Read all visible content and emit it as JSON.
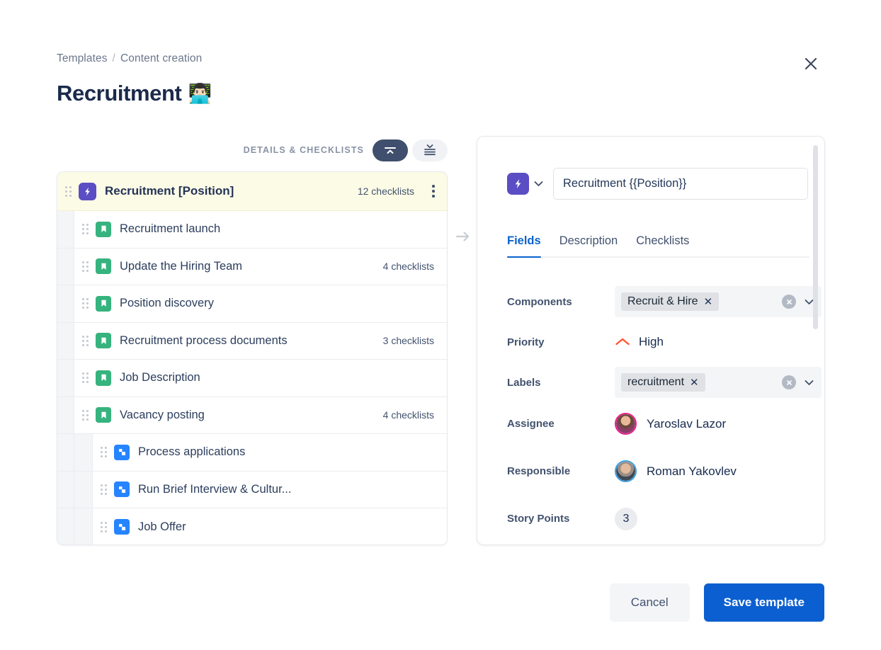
{
  "breadcrumb": {
    "root": "Templates",
    "separator": "/",
    "current": "Content creation"
  },
  "title": {
    "text": "Recruitment",
    "emoji": "👨🏻‍💻"
  },
  "close_icon": "close-icon",
  "toolbar": {
    "label": "DETAILS & CHECKLISTS",
    "collapse_icon": "collapse-all-icon",
    "expand_icon": "expand-all-icon"
  },
  "tree": {
    "items": [
      {
        "title": "Recruitment [Position]",
        "meta": "12 checklists",
        "type": "epic",
        "level": 0,
        "selected": true,
        "has_menu": true
      },
      {
        "title": "Recruitment launch",
        "meta": "",
        "type": "story",
        "level": 1,
        "selected": false,
        "has_menu": false
      },
      {
        "title": "Update the Hiring Team",
        "meta": "4 checklists",
        "type": "story",
        "level": 1,
        "selected": false,
        "has_menu": false
      },
      {
        "title": "Position discovery",
        "meta": "",
        "type": "story",
        "level": 1,
        "selected": false,
        "has_menu": false
      },
      {
        "title": "Recruitment process documents",
        "meta": "3 checklists",
        "type": "story",
        "level": 1,
        "selected": false,
        "has_menu": false
      },
      {
        "title": "Job Description",
        "meta": "",
        "type": "story",
        "level": 1,
        "selected": false,
        "has_menu": false
      },
      {
        "title": "Vacancy posting",
        "meta": "4 checklists",
        "type": "story",
        "level": 1,
        "selected": false,
        "has_menu": false
      },
      {
        "title": "Process applications",
        "meta": "",
        "type": "subtask",
        "level": 2,
        "selected": false,
        "has_menu": false
      },
      {
        "title": "Run Brief Interview & Cultur...",
        "meta": "",
        "type": "subtask",
        "level": 2,
        "selected": false,
        "has_menu": false
      },
      {
        "title": "Job Offer",
        "meta": "",
        "type": "subtask",
        "level": 2,
        "selected": false,
        "has_menu": false
      }
    ]
  },
  "connector_icon": "arrow-right-icon",
  "detail": {
    "type_badge_icon": "epic-lightning-icon",
    "type_chevron_icon": "chevron-down-icon",
    "title_value": "Recruitment {{Position}}",
    "title_placeholder": "Summary",
    "tabs": [
      {
        "label": "Fields",
        "active": true
      },
      {
        "label": "Description",
        "active": false
      },
      {
        "label": "Checklists",
        "active": false
      }
    ],
    "fields": {
      "components": {
        "label": "Components",
        "chip": "Recruit & Hire",
        "chip_remove_icon": "remove-chip-icon",
        "clear_icon": "clear-field-icon",
        "chevron_icon": "chevron-down-icon"
      },
      "priority": {
        "label": "Priority",
        "value": "High",
        "icon": "priority-high-icon",
        "icon_color": "#ff5630"
      },
      "labels": {
        "label": "Labels",
        "chip": "recruitment",
        "chip_remove_icon": "remove-chip-icon",
        "clear_icon": "clear-field-icon",
        "chevron_icon": "chevron-down-icon"
      },
      "assignee": {
        "label": "Assignee",
        "value": "Yaroslav Lazor",
        "avatar_ring": "#e91e8c"
      },
      "responsible": {
        "label": "Responsible",
        "value": "Roman Yakovlev",
        "avatar_ring": "#3fa0e0"
      },
      "story_points": {
        "label": "Story Points",
        "value": "3"
      }
    }
  },
  "footer": {
    "cancel_label": "Cancel",
    "save_label": "Save template"
  },
  "colors": {
    "epic_purple": "#5b4dc4",
    "story_green": "#36b37e",
    "subtask_blue": "#2684ff",
    "primary_blue": "#0b5fd0",
    "tab_blue": "#0b63ce",
    "selected_row": "#fcfbe6",
    "priority_high": "#ff5630"
  }
}
